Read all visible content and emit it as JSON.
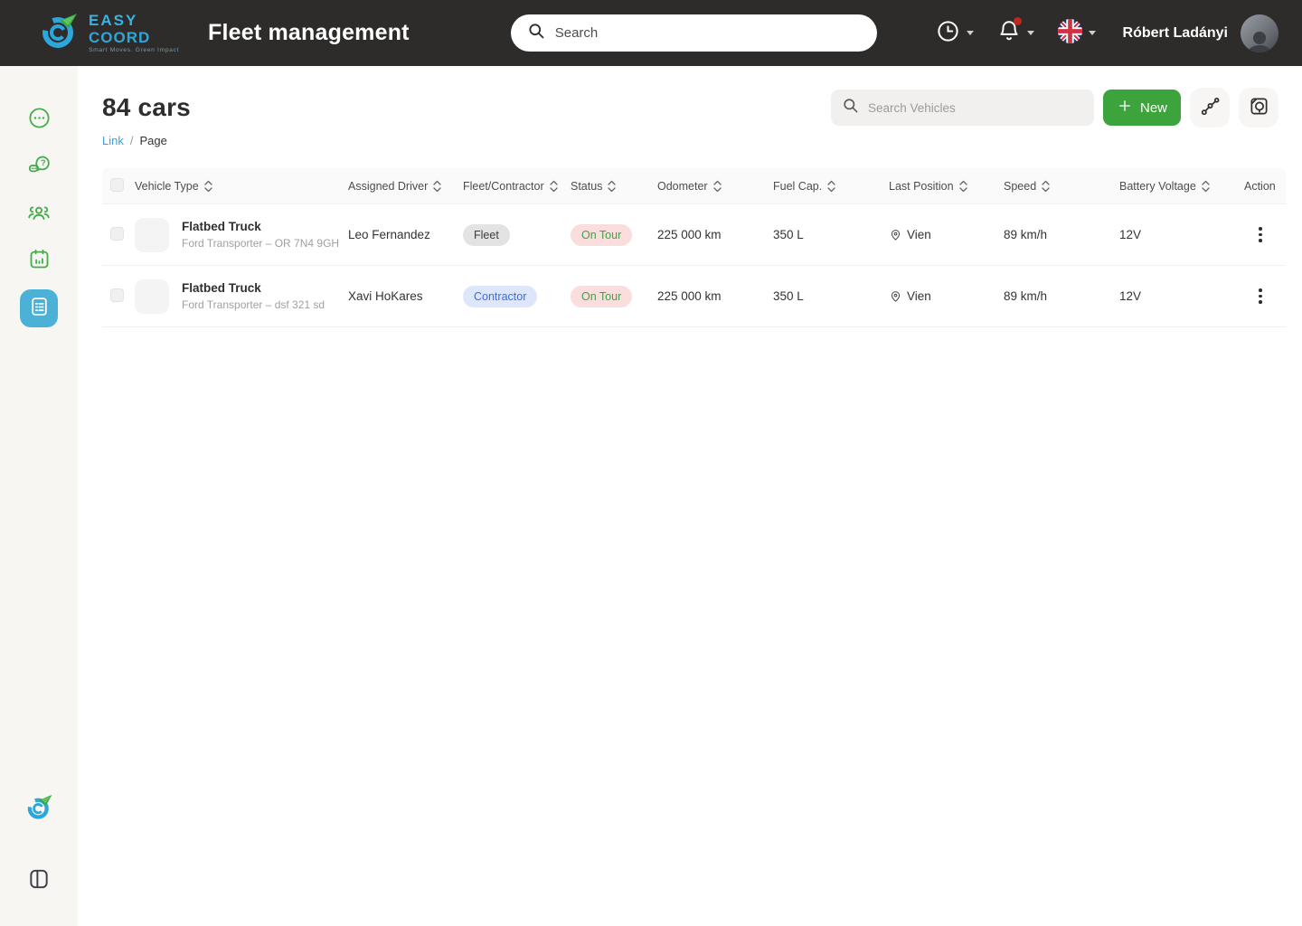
{
  "colors": {
    "topbar_bg": "#2d2c2a",
    "sidebar_bg": "#f7f6f2",
    "accent_green": "#3da33c",
    "sidebar_icon_green": "#43ad4a",
    "active_item_blue": "#4cb1d7",
    "link_blue": "#38a0d8",
    "logo_cyan": "#33b1e0",
    "badge_fleet_bg": "#e3e3e3",
    "badge_contractor_bg": "#dde6fa",
    "badge_contractor_text": "#3d6ce0",
    "badge_status_bg": "#fadddd",
    "badge_status_text": "#43a047",
    "notification_dot": "#c1271b"
  },
  "topbar": {
    "logo": {
      "line1": "EASY",
      "line2": "COORD",
      "tagline": "Smart Moves. Green Impact"
    },
    "app_title": "Fleet management",
    "search_placeholder": "Search",
    "user_name": "Róbert Ladányi"
  },
  "sidebar": {
    "items": [
      {
        "name": "more",
        "icon": "ellipsis-circle-icon",
        "active": false
      },
      {
        "name": "support",
        "icon": "chat-question-icon",
        "active": false
      },
      {
        "name": "team",
        "icon": "users-icon",
        "active": false
      },
      {
        "name": "schedule",
        "icon": "calendar-chart-icon",
        "active": false
      },
      {
        "name": "fleet",
        "icon": "document-list-icon",
        "active": true
      }
    ]
  },
  "page": {
    "title": "84 cars",
    "breadcrumb": {
      "link": "Link",
      "separator": "/",
      "current": "Page"
    },
    "toolbar": {
      "search_placeholder": "Search Vehicles",
      "new_button": "New"
    }
  },
  "table": {
    "columns": [
      {
        "label": "Vehicle Type",
        "sortable": true
      },
      {
        "label": "Assigned Driver",
        "sortable": true
      },
      {
        "label": "Fleet/Contractor",
        "sortable": true
      },
      {
        "label": "Status",
        "sortable": true
      },
      {
        "label": "Odometer",
        "sortable": true
      },
      {
        "label": "Fuel Cap.",
        "sortable": true
      },
      {
        "label": "Last Position",
        "sortable": true
      },
      {
        "label": "Speed",
        "sortable": true
      },
      {
        "label": "Battery Voltage",
        "sortable": true
      },
      {
        "label": "Action",
        "sortable": false
      }
    ],
    "rows": [
      {
        "vehicle": {
          "name": "Flatbed Truck",
          "subtitle": "Ford Transporter – OR 7N4 9GH"
        },
        "driver": "Leo Fernandez",
        "fleet_contractor": "Fleet",
        "status": "On Tour",
        "odometer": "225 000 km",
        "fuel_cap": "350 L",
        "last_position": "Vien",
        "speed": "89 km/h",
        "battery_voltage": "12V"
      },
      {
        "vehicle": {
          "name": "Flatbed Truck",
          "subtitle": "Ford Transporter – dsf 321 sd"
        },
        "driver": "Xavi HoKares",
        "fleet_contractor": "Contractor",
        "status": "On Tour",
        "odometer": "225 000 km",
        "fuel_cap": "350 L",
        "last_position": "Vien",
        "speed": "89 km/h",
        "battery_voltage": "12V"
      }
    ]
  }
}
